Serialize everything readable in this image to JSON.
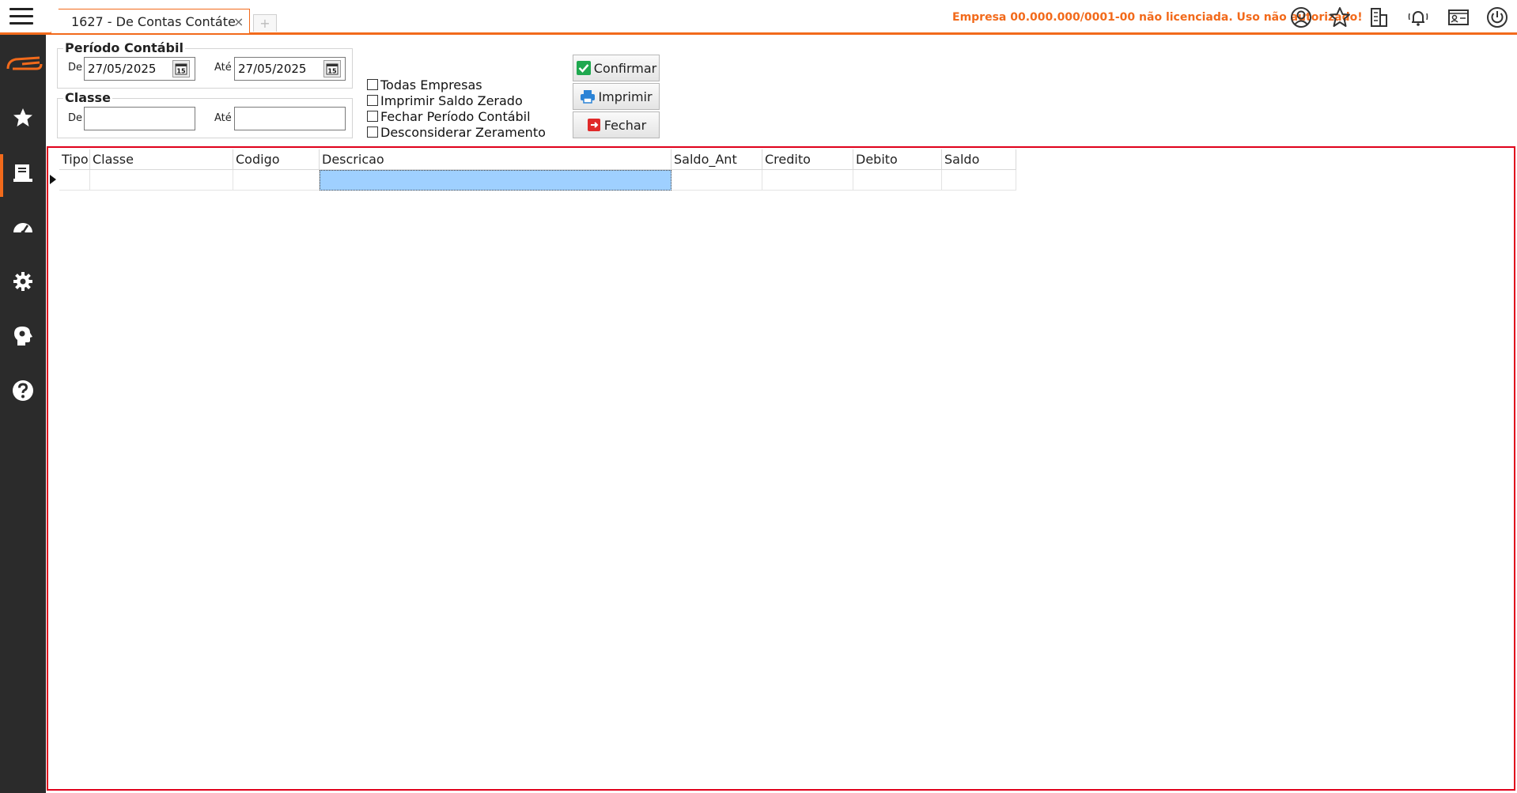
{
  "tab": {
    "label": "1627 - De Contas Contáte",
    "close": "×",
    "new": "+"
  },
  "header": {
    "license_warning": "Empresa 00.000.000/0001-00 não licenciada. Uso não autorizado!"
  },
  "icons": {
    "top": [
      "user-icon",
      "star-icon",
      "building-icon",
      "notification-bell-icon",
      "contact-card-icon",
      "power-icon"
    ],
    "sidebar": [
      "logo-icon",
      "favorites-star-icon",
      "reports-icon",
      "dashboard-gauge-icon",
      "settings-gear-icon",
      "support-head-icon",
      "help-icon"
    ]
  },
  "colors": {
    "accent": "#f26a1b",
    "sidebar": "#2b2b2b",
    "grid_border": "#e0001b",
    "selected_cell": "#9fd0ff"
  },
  "periodo": {
    "legend": "Período Contábil",
    "de_label": "De",
    "de_value": "27/05/2025",
    "ate_label": "Até",
    "ate_value": "27/05/2025",
    "calendar_glyph": "15"
  },
  "classe": {
    "legend": "Classe",
    "de_label": "De",
    "de_value": "",
    "ate_label": "Até",
    "ate_value": ""
  },
  "options": [
    {
      "label": "Todas Empresas",
      "checked": false
    },
    {
      "label": "Imprimir Saldo Zerado",
      "checked": false
    },
    {
      "label": "Fechar Período Contábil",
      "checked": false
    },
    {
      "label": "Desconsiderar Zeramento",
      "checked": false
    }
  ],
  "buttons": {
    "confirmar": "Confirmar",
    "imprimir": "Imprimir",
    "fechar": "Fechar"
  },
  "grid": {
    "columns": [
      "Tipo",
      "Classe",
      "Codigo",
      "Descricao",
      "Saldo_Ant",
      "Credito",
      "Debito",
      "Saldo"
    ]
  }
}
